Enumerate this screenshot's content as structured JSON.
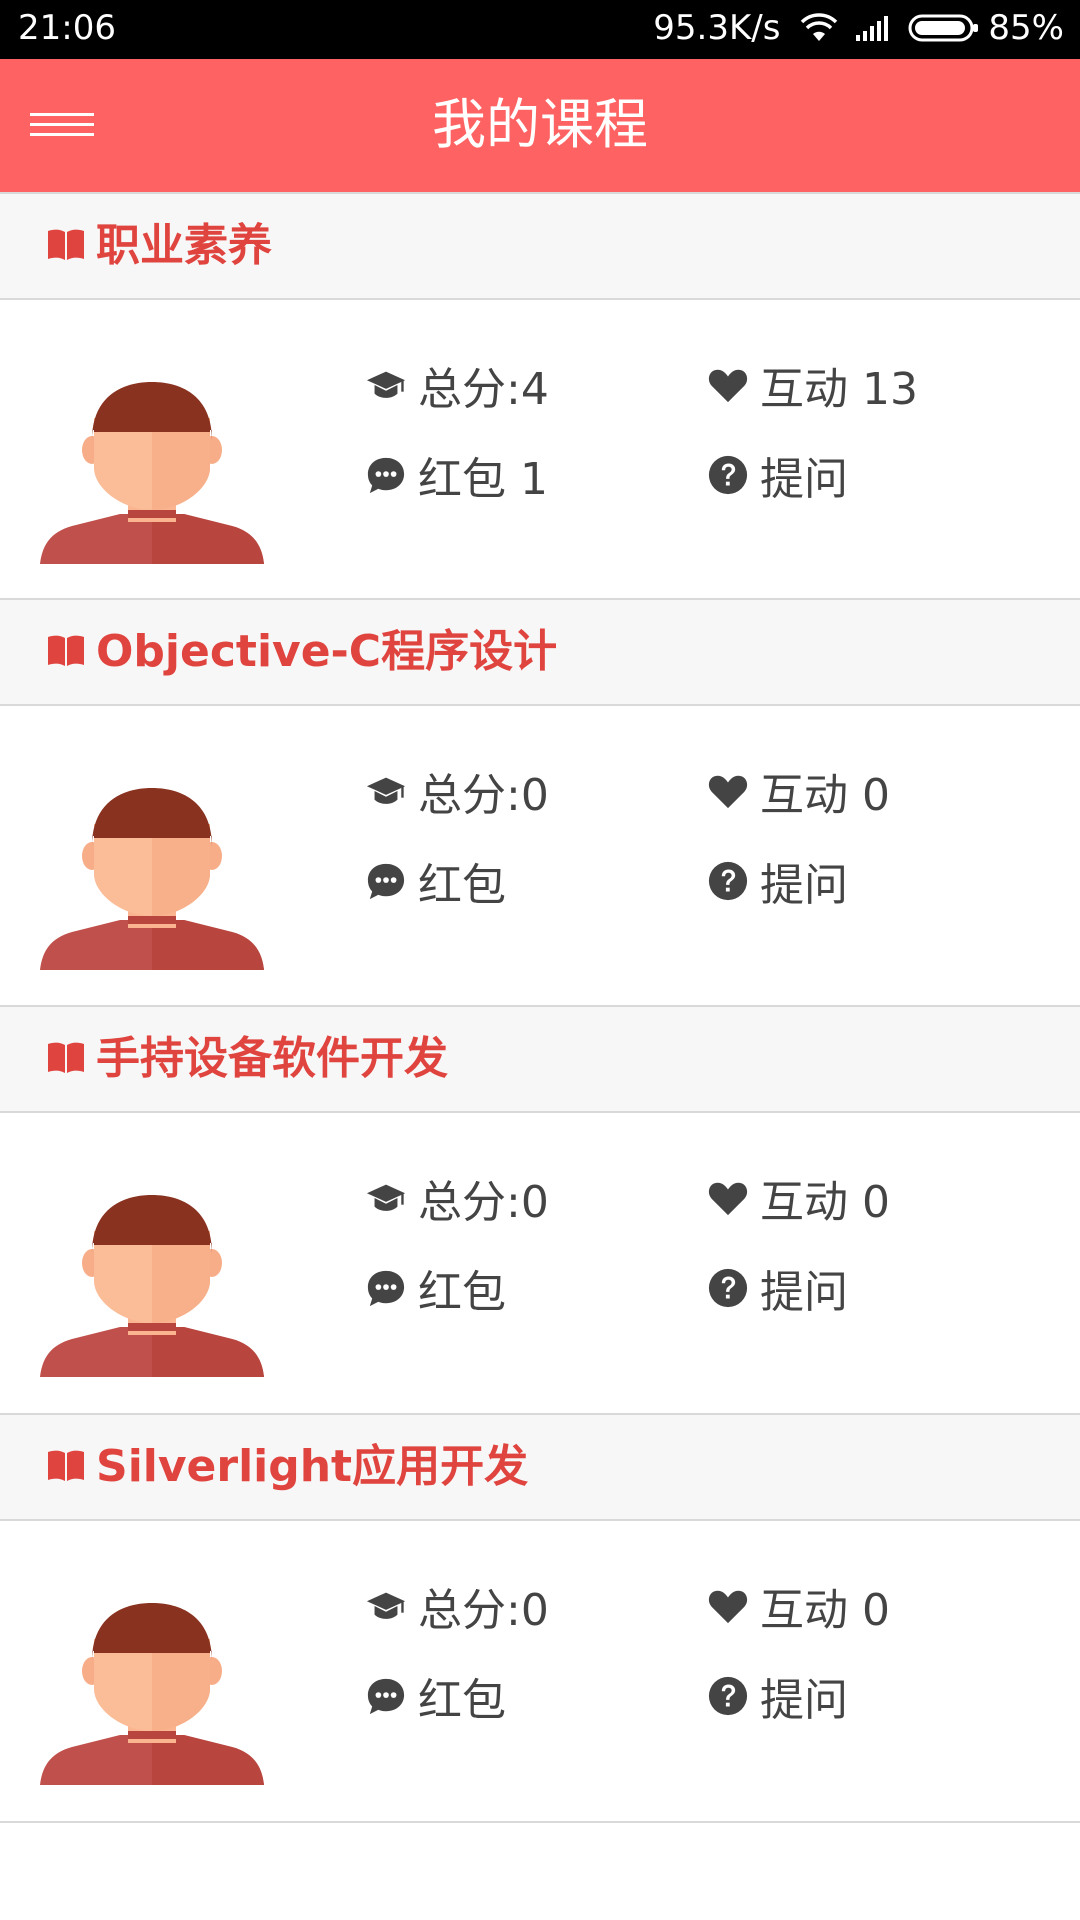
{
  "status_bar": {
    "time": "21:06",
    "net_speed": "95.3K/s",
    "battery": "85%"
  },
  "app_bar": {
    "title": "我的课程",
    "menu_icon": "hamburger-menu-icon",
    "background": "#ff6262"
  },
  "colors": {
    "accent": "#e0443f",
    "text": "#444444",
    "header_bg": "#f7f7f7"
  },
  "courses": [
    {
      "name": "职业素养",
      "score": "总分:4",
      "interaction": "互动 13",
      "red_packet": "红包 1",
      "question": "提问"
    },
    {
      "name": "Objective-C程序设计",
      "score": "总分:0",
      "interaction": "互动 0",
      "red_packet": "红包",
      "question": "提问"
    },
    {
      "name": "手持设备软件开发",
      "score": "总分:0",
      "interaction": "互动 0",
      "red_packet": "红包",
      "question": "提问"
    },
    {
      "name": "Silverlight应用开发",
      "score": "总分:0",
      "interaction": "互动 0",
      "red_packet": "红包",
      "question": "提问"
    }
  ],
  "icons": {
    "course": "book-icon",
    "score": "graduation-cap-icon",
    "interaction": "heart-icon",
    "red_packet": "chat-bubble-icon",
    "question": "question-circle-icon",
    "avatar": "user-avatar"
  }
}
